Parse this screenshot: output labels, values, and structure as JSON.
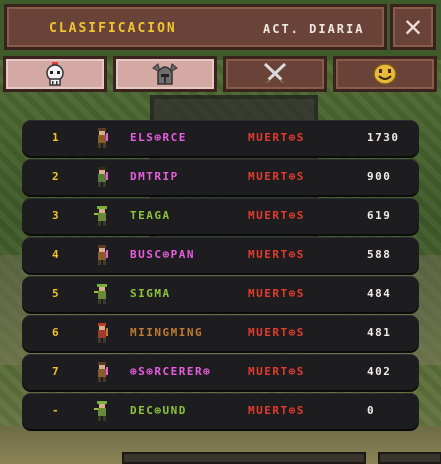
{
  "header": {
    "title": "CLASIFICACION",
    "subtitle": "ACT. DIARIA",
    "close_label": "✕"
  },
  "tabs": [
    {
      "icon": "skull-icon",
      "state": "light"
    },
    {
      "icon": "horned-helmet-icon",
      "state": "light"
    },
    {
      "icon": "crossed-swords-icon",
      "state": "dark"
    },
    {
      "icon": "smiley-face-icon",
      "state": "dark"
    }
  ],
  "leaderboard": [
    {
      "rank": "1",
      "name": "ELS⊕RCE",
      "status": "MUERT⊕S",
      "score": "1730",
      "name_color": "#e85ee0"
    },
    {
      "rank": "2",
      "name": "DMTRIP",
      "status": "MUERT⊕S",
      "score": "900",
      "name_color": "#e85ee0"
    },
    {
      "rank": "3",
      "name": "TEAGA",
      "status": "MUERT⊕S",
      "score": "619",
      "name_color": "#8cc43c"
    },
    {
      "rank": "4",
      "name": "BUSC⊕PAN",
      "status": "MUERT⊕S",
      "score": "588",
      "name_color": "#e85ee0"
    },
    {
      "rank": "5",
      "name": "SIGMA",
      "status": "MUERT⊕S",
      "score": "484",
      "name_color": "#8cc43c"
    },
    {
      "rank": "6",
      "name": "MIINGMING",
      "status": "MUERT⊕S",
      "score": "481",
      "name_color": "#c07a33"
    },
    {
      "rank": "7",
      "name": "⊕S⊕RCERER⊕",
      "status": "MUERT⊕S",
      "score": "402",
      "name_color": "#e85ee0"
    },
    {
      "rank": "-",
      "name": "DEC⊕UND",
      "status": "MUERT⊕S",
      "score": "0",
      "name_color": "#8cc43c"
    }
  ],
  "colors": {
    "rank": "#f3c430",
    "status": "#e43b2f",
    "score": "#f2ece8"
  }
}
